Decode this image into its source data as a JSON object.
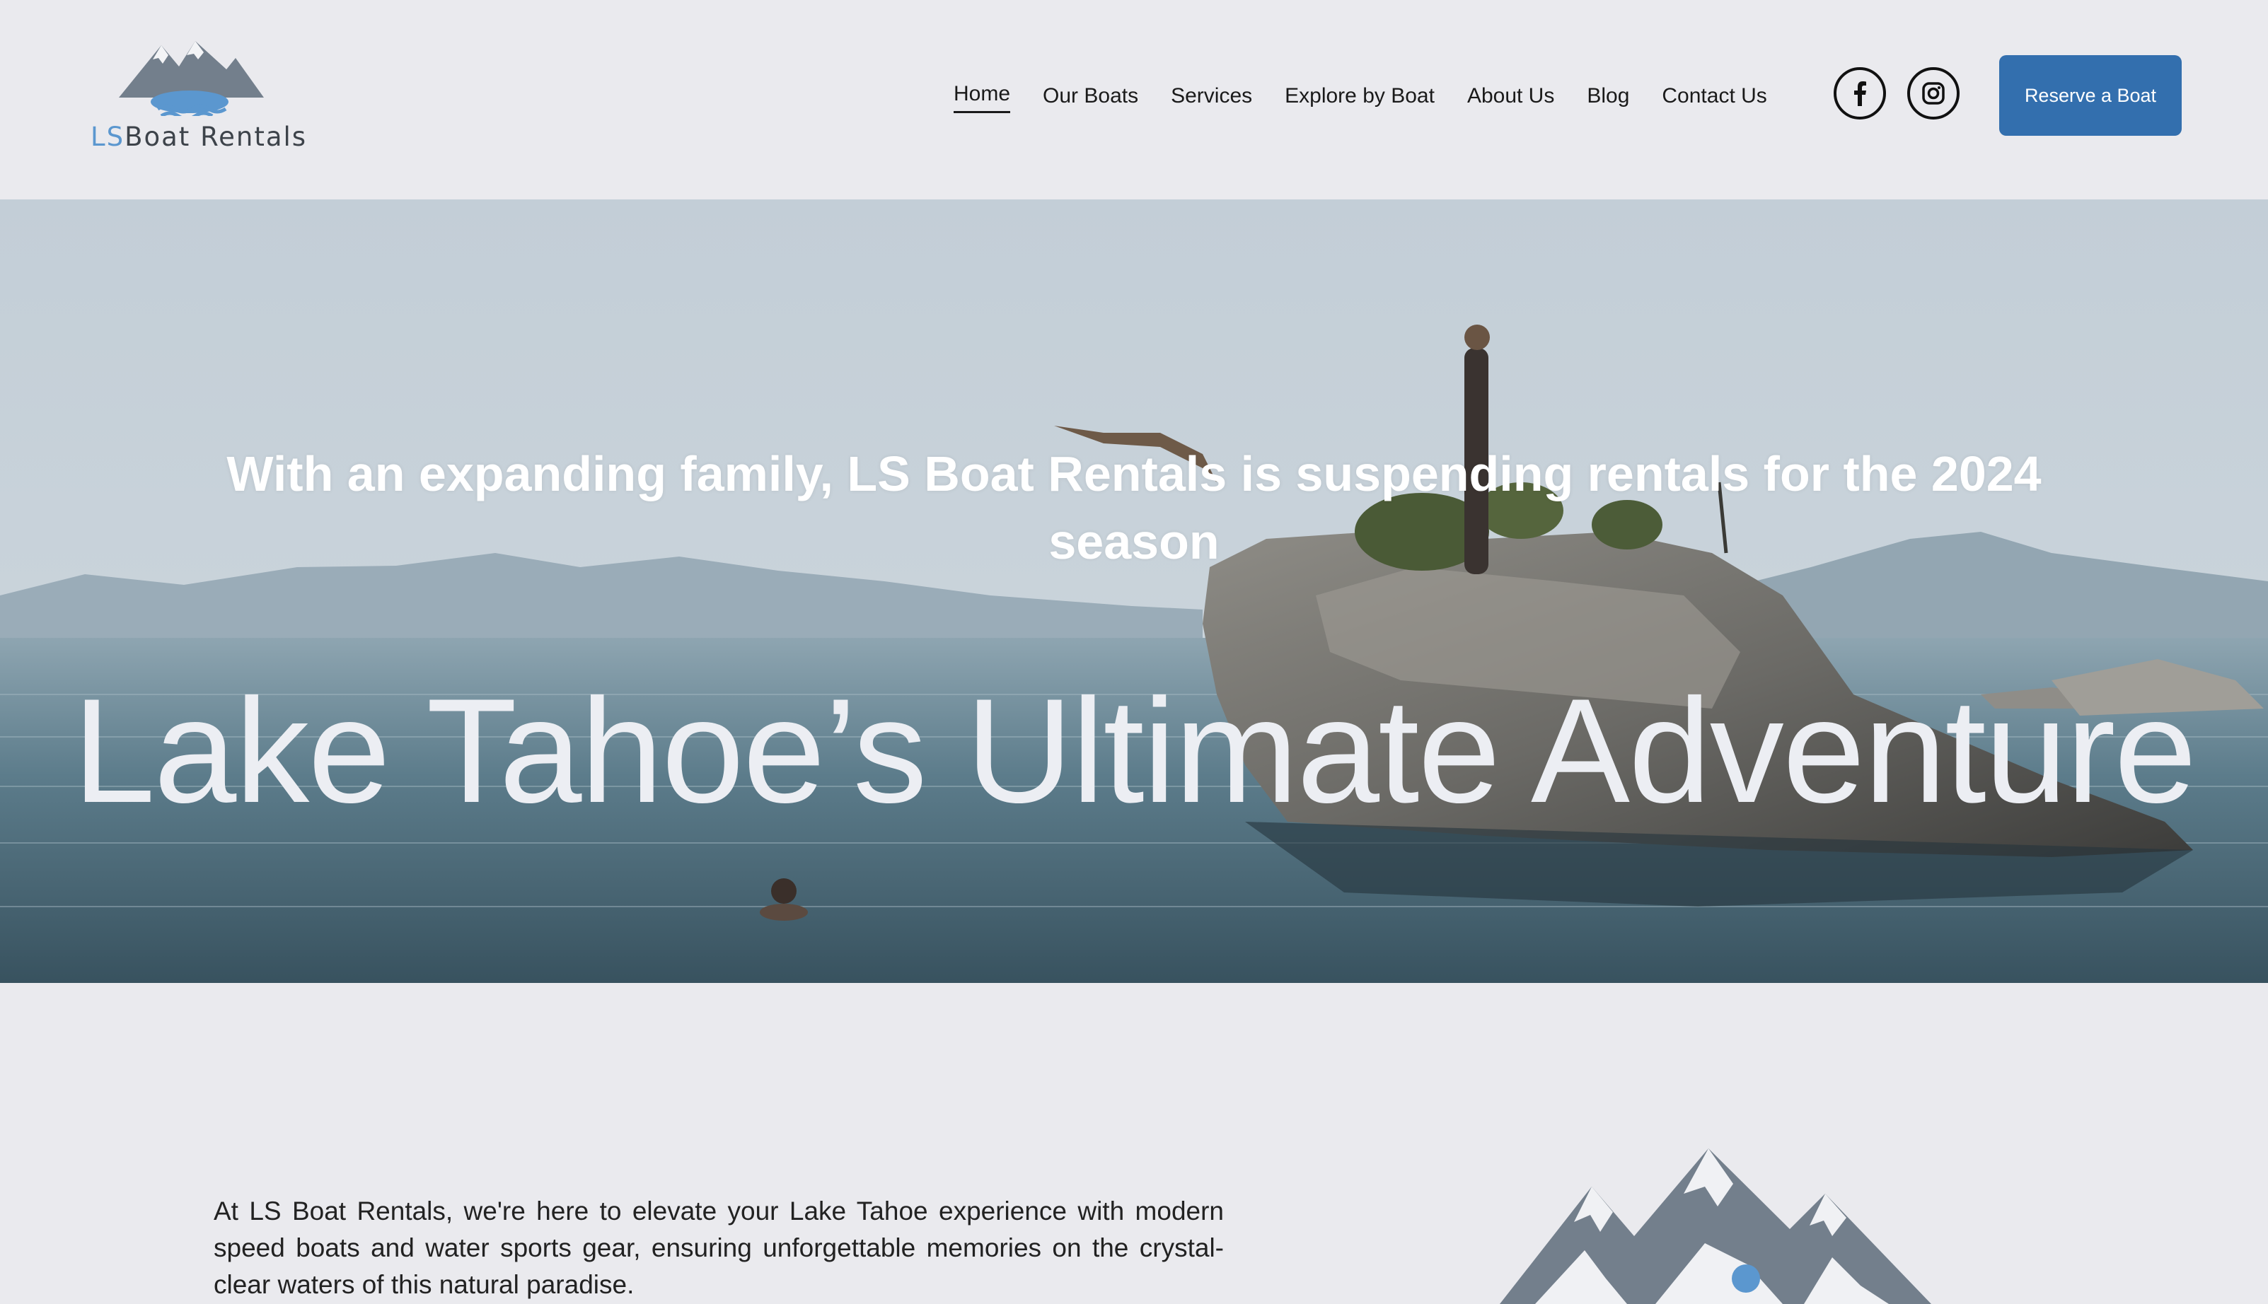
{
  "brand": {
    "logo_initials": "LS",
    "logo_text": "Boat Rentals"
  },
  "nav": {
    "items": [
      {
        "label": "Home",
        "active": true
      },
      {
        "label": "Our Boats",
        "active": false
      },
      {
        "label": "Services",
        "active": false
      },
      {
        "label": "Explore by Boat",
        "active": false
      },
      {
        "label": "About Us",
        "active": false
      },
      {
        "label": "Blog",
        "active": false
      },
      {
        "label": "Contact Us",
        "active": false
      }
    ],
    "social": [
      "facebook-icon",
      "instagram-icon"
    ],
    "cta_label": "Reserve a Boat"
  },
  "hero": {
    "announcement": "With an expanding family, LS Boat Rentals is suspending rentals for the 2024 season",
    "headline": "Lake Tahoe’s Ultimate Adventure"
  },
  "intro": {
    "text": "At LS Boat Rentals, we're here to elevate your Lake Tahoe experience with modern speed boats and water sports gear, ensuring unforgettable memories on the crystal-clear waters of this natural paradise."
  },
  "colors": {
    "accent": "#336fae",
    "logo_blue": "#5b97cf",
    "mountain_gray": "#737f8c",
    "page_bg": "#eaeaee"
  }
}
